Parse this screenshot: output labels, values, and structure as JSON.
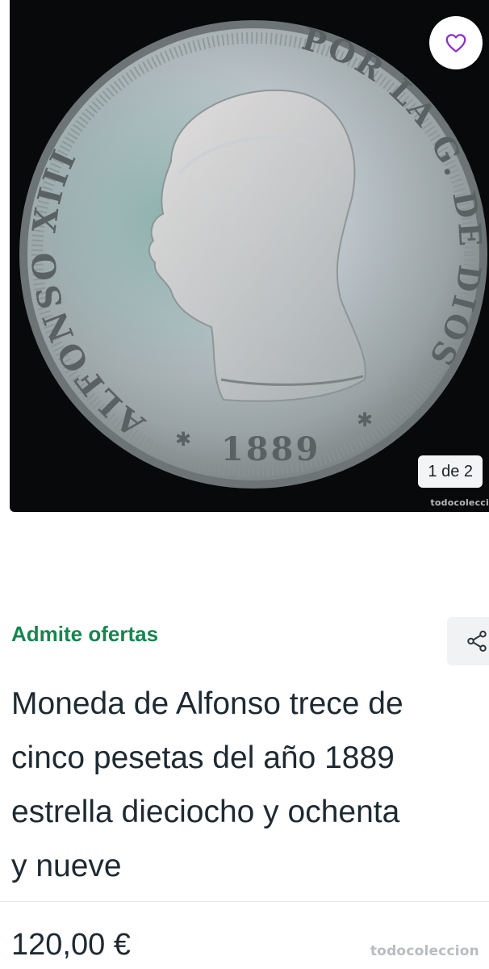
{
  "gallery": {
    "coin": {
      "legend_left": "ALFONSO XIII",
      "legend_right": "POR LA G. DE DIOS",
      "year": "1889"
    },
    "counter_text": "1 de 2",
    "image_watermark": "todocolecci"
  },
  "favorite": {
    "icon": "heart-icon",
    "color": "#8b2fc9"
  },
  "listing": {
    "offers_label": "Admite ofertas",
    "offers_color": "#16854f",
    "share_icon": "share-icon",
    "title_lines": [
      "Moneda de Alfonso trece de",
      "cinco pesetas del año 1889",
      "estrella dieciocho y ochenta",
      "y nueve"
    ],
    "price": "120,00 €"
  },
  "watermark": {
    "text": "todocoleccion"
  }
}
